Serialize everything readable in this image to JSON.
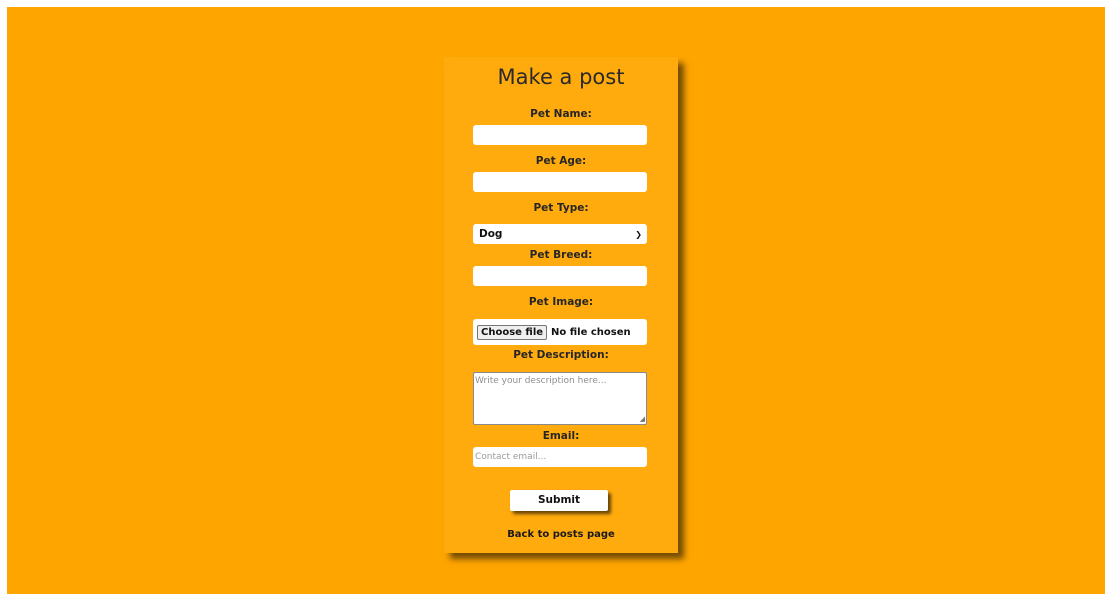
{
  "form": {
    "title": "Make a post",
    "pet_name_label": "Pet Name:",
    "pet_name_value": "",
    "pet_age_label": "Pet Age:",
    "pet_age_value": "",
    "pet_type_label": "Pet Type:",
    "pet_type_selected": "Dog",
    "pet_breed_label": "Pet Breed:",
    "pet_breed_value": "",
    "pet_image_label": "Pet Image:",
    "choose_file_label": "Choose file",
    "file_status": "No file chosen",
    "pet_description_label": "Pet Description:",
    "description_placeholder": "Write your description here...",
    "email_label": "Email:",
    "email_placeholder": "Contact email...",
    "submit_label": "Submit",
    "back_link": "Back to posts page"
  },
  "colors": {
    "background": "#ffa500",
    "card": "#ffaa0d"
  },
  "icons": {
    "select_arrow": "chevron-down-icon",
    "resize_handle": "resize-grip-icon"
  }
}
